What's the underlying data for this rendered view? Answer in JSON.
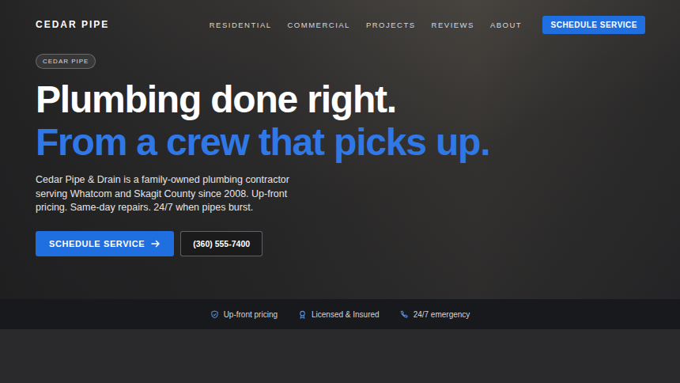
{
  "nav": {
    "logo": "CEDAR PIPE",
    "links": [
      "RESIDENTIAL",
      "COMMERCIAL",
      "PROJECTS",
      "REVIEWS",
      "ABOUT"
    ],
    "cta": "SCHEDULE SERVICE"
  },
  "hero": {
    "badge": "CEDAR PIPE",
    "headline": "Plumbing done right.",
    "headline_accent": "From a crew that picks up.",
    "body": "Cedar Pipe & Drain is a family-owned plumbing contractor serving Whatcom and Skagit County since 2008. Up-front pricing. Same-day repairs. 24/7 when pipes burst.",
    "primary_button": "SCHEDULE SERVICE",
    "phone_button": "(360) 555-7400"
  },
  "trust": [
    {
      "label": "Up-front pricing",
      "kind": "shield"
    },
    {
      "label": "Licensed & Insured",
      "kind": "badge"
    },
    {
      "label": "24/7 emergency",
      "kind": "phone"
    }
  ]
}
